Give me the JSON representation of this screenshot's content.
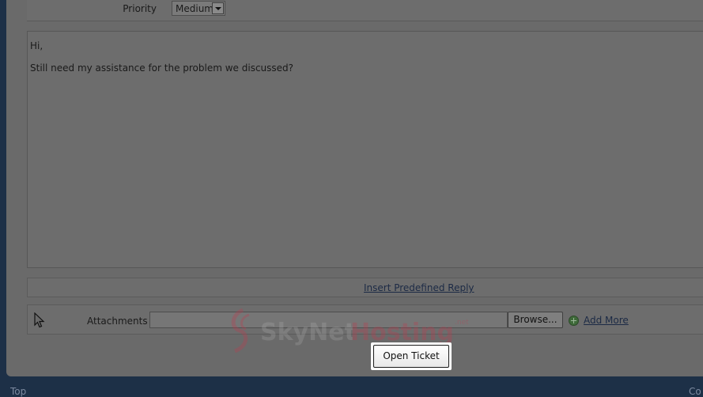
{
  "form": {
    "priority_label": "Priority",
    "priority_value": "Medium",
    "message_lines": [
      "Hi,",
      "Still need my assistance for the problem we discussed?"
    ],
    "insert_predefined_reply": "Insert Predefined Reply",
    "attachments_label": "Attachments",
    "browse_label": "Browse...",
    "add_more_label": "Add More",
    "open_ticket_label": "Open Ticket"
  },
  "watermark": {
    "text_dark": "SkyNet",
    "text_light": "Hosting",
    "sub": ".net",
    "color": "#c0394d"
  },
  "footer": {
    "left_text": "Top",
    "right_text": "Co"
  }
}
